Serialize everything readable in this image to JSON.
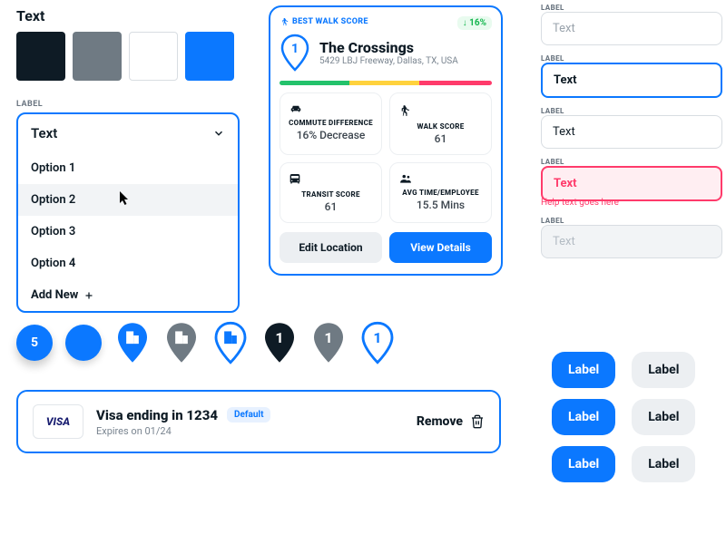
{
  "text_label": "Text",
  "swatches": [
    "#0e1b25",
    "#6f7a83",
    "#ffffff",
    "#0b78ff"
  ],
  "dropdown": {
    "label": "LABEL",
    "selected": "Text",
    "options": [
      "Option 1",
      "Option 2",
      "Option 3",
      "Option 4"
    ],
    "add_new": "Add New"
  },
  "card": {
    "badge": "BEST WALK SCORE",
    "delta": "↓ 16%",
    "pin_value": "1",
    "title": "The Crossings",
    "subtitle": "5429 LBJ Freeway, Dallas, TX, USA",
    "bar_colors": [
      "#23c26b",
      "#ffd23d",
      "#ff3b6b"
    ],
    "stats": [
      {
        "label": "COMMUTE DIFFERENCE",
        "value": "16% Decrease"
      },
      {
        "label": "WALK SCORE",
        "value": "61"
      },
      {
        "label": "TRANSIT SCORE",
        "value": "61"
      },
      {
        "label": "AVG TIME/EMPLOYEE",
        "value": "15.5 Mins"
      }
    ],
    "edit": "Edit Location",
    "view": "View Details"
  },
  "pins": {
    "count_value": "5",
    "num": "1"
  },
  "payment": {
    "brand": "VISA",
    "title": "Visa ending in 1234",
    "default": "Default",
    "expires": "Expires on 01/24",
    "remove": "Remove"
  },
  "inputs": {
    "label": "LABEL",
    "placeholder": "Text",
    "value": "Text",
    "help": "Help text goes here"
  },
  "chips": {
    "primary": "Label",
    "secondary": "Label"
  }
}
